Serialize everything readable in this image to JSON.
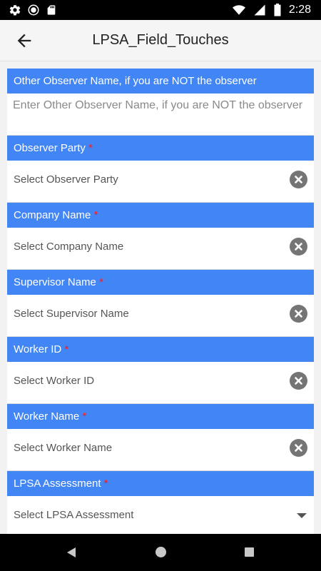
{
  "status_bar": {
    "time": "2:28",
    "icons": [
      "gear-icon",
      "record-icon",
      "sd-card-icon",
      "wifi-icon",
      "signal-icon",
      "battery-icon"
    ]
  },
  "app_bar": {
    "title": "LPSA_Field_Touches",
    "back_icon": "arrow-back-icon"
  },
  "form": {
    "fields": [
      {
        "label": "Other Observer Name, if you are NOT the observer",
        "required": false,
        "type": "text",
        "placeholder": "Enter Other Observer Name, if you are NOT the observer"
      },
      {
        "label": "Observer Party",
        "required_mark": "*",
        "type": "select",
        "value": "Select Observer Party",
        "action_icon": "clear-icon"
      },
      {
        "label": "Company Name",
        "required_mark": "*",
        "type": "select",
        "value": "Select Company Name",
        "action_icon": "clear-icon"
      },
      {
        "label": "Supervisor Name",
        "required_mark": "*",
        "type": "select",
        "value": "Select Supervisor Name",
        "action_icon": "clear-icon"
      },
      {
        "label": "Worker ID",
        "required_mark": "*",
        "type": "select",
        "value": "Select Worker ID",
        "action_icon": "clear-icon"
      },
      {
        "label": "Worker Name",
        "required_mark": "*",
        "type": "select",
        "value": "Select Worker Name",
        "action_icon": "clear-icon"
      },
      {
        "label": "LPSA Assessment",
        "required_mark": "*",
        "type": "dropdown",
        "value": "Select LPSA Assessment",
        "action_icon": "dropdown-arrow-icon"
      }
    ]
  },
  "colors": {
    "header_blue": "#4285f4",
    "required_red": "#ff1a1a",
    "clear_button_gray": "#757575"
  },
  "nav_bar": {
    "icons": [
      "nav-back-icon",
      "nav-home-icon",
      "nav-recents-icon"
    ]
  }
}
